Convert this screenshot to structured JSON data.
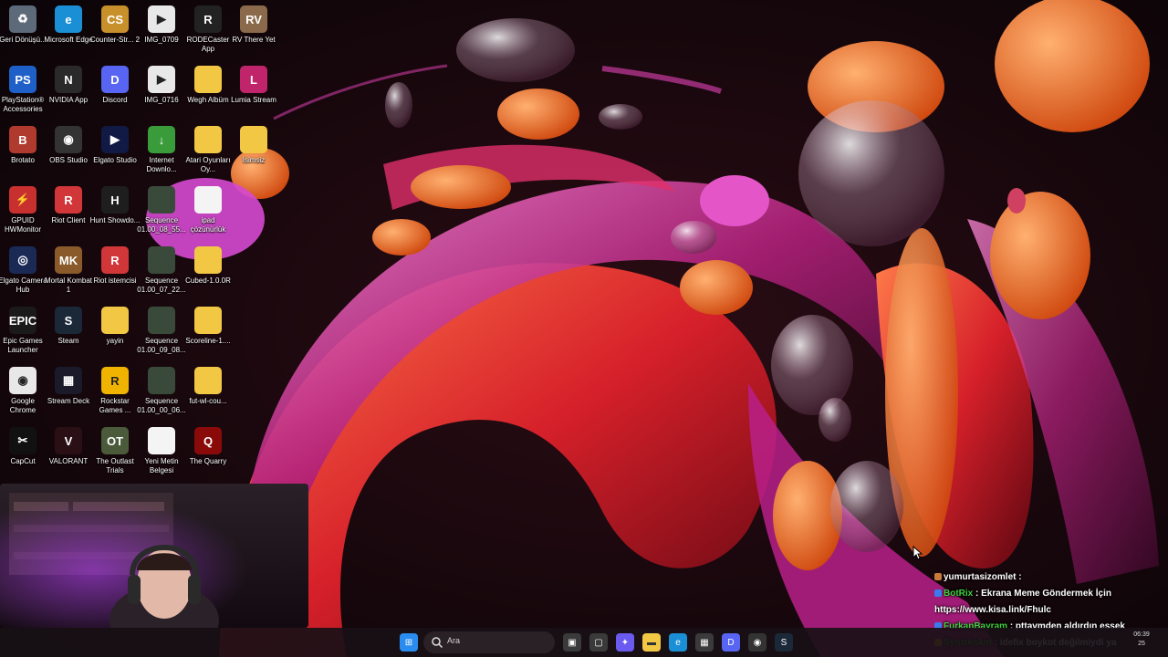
{
  "desktop": {
    "icons": [
      {
        "label": "Geri Dönüşü...",
        "icon": "recycle-bin-icon",
        "color": "#5c6a7a",
        "glyph": "♻"
      },
      {
        "label": "Microsoft Edge",
        "icon": "edge-icon",
        "color": "#1b8fd6",
        "glyph": "e"
      },
      {
        "label": "Counter-Str... 2",
        "icon": "cs2-icon",
        "color": "#c8902a",
        "glyph": "CS"
      },
      {
        "label": "IMG_0709",
        "icon": "video-file-icon",
        "color": "#e8e8e8",
        "glyph": "▶"
      },
      {
        "label": "RODECaster App",
        "icon": "rodecaster-icon",
        "color": "#222222",
        "glyph": "R"
      },
      {
        "label": "RV There Yet",
        "icon": "rv-there-yet-icon",
        "color": "#8a6a4a",
        "glyph": "RV"
      },
      {
        "label": "PlayStation® Accessories",
        "icon": "playstation-icon",
        "color": "#1f5fc8",
        "glyph": "PS"
      },
      {
        "label": "NVIDIA App",
        "icon": "nvidia-icon",
        "color": "#2a2a2a",
        "glyph": "N"
      },
      {
        "label": "Discord",
        "icon": "discord-icon",
        "color": "#5865f2",
        "glyph": "D"
      },
      {
        "label": "IMG_0716",
        "icon": "video-file-icon",
        "color": "#e8e8e8",
        "glyph": "▶"
      },
      {
        "label": "Wegh Albüm",
        "icon": "folder-icon",
        "color": "#f2c744",
        "glyph": ""
      },
      {
        "label": "Lumia Stream",
        "icon": "lumia-stream-icon",
        "color": "#c0246a",
        "glyph": "L"
      },
      {
        "label": "Brotato",
        "icon": "brotato-icon",
        "color": "#b03a2e",
        "glyph": "B"
      },
      {
        "label": "OBS Studio",
        "icon": "obs-icon",
        "color": "#333333",
        "glyph": "◉"
      },
      {
        "label": "Elgato Studio",
        "icon": "elgato-studio-icon",
        "color": "#111a44",
        "glyph": "▶"
      },
      {
        "label": "Internet Downlo...",
        "icon": "idm-icon",
        "color": "#3a9b3a",
        "glyph": "↓"
      },
      {
        "label": "Atari Oyunları Oy...",
        "icon": "folder-icon",
        "color": "#f2c744",
        "glyph": ""
      },
      {
        "label": "İsimsiz",
        "icon": "folder-icon",
        "color": "#f2c744",
        "glyph": ""
      },
      {
        "label": "GPUID HWMonitor",
        "icon": "hwmonitor-icon",
        "color": "#c83030",
        "glyph": "⚡"
      },
      {
        "label": "Riot Client",
        "icon": "riot-client-icon",
        "color": "#d13639",
        "glyph": "R"
      },
      {
        "label": "Hunt Showdo...",
        "icon": "hunt-showdown-icon",
        "color": "#1e1e1e",
        "glyph": "H"
      },
      {
        "label": "Sequence 01.00_08_55...",
        "icon": "video-thumbnail-icon",
        "color": "#3a4a3a",
        "glyph": ""
      },
      {
        "label": "ipad çözünürlük",
        "icon": "text-file-icon",
        "color": "#f4f4f4",
        "glyph": ""
      },
      {
        "label": "Elgato Camera Hub",
        "icon": "elgato-camera-hub-icon",
        "color": "#1a2a55",
        "glyph": "◎"
      },
      {
        "label": "Mortal Kombat 1",
        "icon": "mortal-kombat-icon",
        "color": "#8a5a2a",
        "glyph": "MK"
      },
      {
        "label": "Riot istemcisi",
        "icon": "riot-client-icon",
        "color": "#d13639",
        "glyph": "R"
      },
      {
        "label": "Sequence 01.00_07_22...",
        "icon": "video-thumbnail-icon",
        "color": "#3a4a3a",
        "glyph": ""
      },
      {
        "label": "Cubed-1.0.0R",
        "icon": "folder-icon",
        "color": "#f2c744",
        "glyph": ""
      },
      {
        "label": "Epic Games Launcher",
        "icon": "epic-games-icon",
        "color": "#1a1a1a",
        "glyph": "EPIC"
      },
      {
        "label": "Steam",
        "icon": "steam-icon",
        "color": "#1b2838",
        "glyph": "S"
      },
      {
        "label": "yayin",
        "icon": "folder-icon",
        "color": "#f2c744",
        "glyph": ""
      },
      {
        "label": "Sequence 01.00_09_08...",
        "icon": "video-thumbnail-icon",
        "color": "#3a4a3a",
        "glyph": ""
      },
      {
        "label": "Scoreline-1....",
        "icon": "folder-icon",
        "color": "#f2c744",
        "glyph": ""
      },
      {
        "label": "Google Chrome",
        "icon": "chrome-icon",
        "color": "#e8e8e8",
        "glyph": "◉"
      },
      {
        "label": "Stream Deck",
        "icon": "stream-deck-icon",
        "color": "#1a1a2a",
        "glyph": "▦"
      },
      {
        "label": "Rockstar Games ...",
        "icon": "rockstar-icon",
        "color": "#f0b400",
        "glyph": "R"
      },
      {
        "label": "Sequence 01.00_00_06...",
        "icon": "video-thumbnail-icon",
        "color": "#3a4a3a",
        "glyph": ""
      },
      {
        "label": "fut-wl-cou...",
        "icon": "folder-icon",
        "color": "#f2c744",
        "glyph": ""
      },
      {
        "label": "CapCut",
        "icon": "capcut-icon",
        "color": "#111111",
        "glyph": "✂"
      },
      {
        "label": "VALORANT",
        "icon": "valorant-icon",
        "color": "#2a1015",
        "glyph": "V"
      },
      {
        "label": "The Outlast Trials",
        "icon": "outlast-icon",
        "color": "#4a5a3a",
        "glyph": "OT"
      },
      {
        "label": "Yeni Metin Belgesi",
        "icon": "text-file-icon",
        "color": "#f4f4f4",
        "glyph": ""
      },
      {
        "label": "The Quarry",
        "icon": "the-quarry-icon",
        "color": "#8a0a0a",
        "glyph": "Q"
      }
    ]
  },
  "taskbar": {
    "search_placeholder": "Ara",
    "time": "06:39",
    "date": "25",
    "pinned": [
      {
        "icon": "start-icon",
        "color": "#2a8cf0",
        "glyph": "⊞"
      },
      {
        "icon": "widgets-icon",
        "color": "#3a3a3a",
        "glyph": "▣"
      },
      {
        "icon": "task-view-icon",
        "color": "#3a3a3a",
        "glyph": "▢"
      },
      {
        "icon": "copilot-icon",
        "color": "#6a5af0",
        "glyph": "✦"
      },
      {
        "icon": "file-explorer-icon",
        "color": "#f2c744",
        "glyph": "▬"
      },
      {
        "icon": "edge-icon",
        "color": "#1b8fd6",
        "glyph": "e"
      },
      {
        "icon": "microsoft-store-icon",
        "color": "#3a3a3a",
        "glyph": "▦"
      },
      {
        "icon": "discord-icon",
        "color": "#5865f2",
        "glyph": "D"
      },
      {
        "icon": "obs-icon",
        "color": "#333333",
        "glyph": "◉"
      },
      {
        "icon": "steam-icon",
        "color": "#1b2838",
        "glyph": "S"
      }
    ]
  },
  "chat": {
    "messages": [
      {
        "user": "yumurtasizomlet",
        "text": ":",
        "user_color": "#ffffff",
        "badge_color": "#c87a3a"
      },
      {
        "user": "BotRix",
        "text": ": Ekrana Meme Göndermek İçin",
        "user_color": "#3ecf3e",
        "badge_color": "#3a7aef"
      },
      {
        "user": "",
        "text": "https://www.kisa.link/Fhulc",
        "user_color": "#ffffff",
        "badge_color": ""
      },
      {
        "user": "FurkanBayram",
        "text": ": pttavmden aldırdın essek",
        "user_color": "#3ecf3e",
        "badge_color": "#3a7aef"
      },
      {
        "user": "Synixknkm",
        "text": ": idefix boykot değilmiydi ya",
        "user_color": "#3ecf3e",
        "badge_color": "#f0c020"
      }
    ]
  }
}
